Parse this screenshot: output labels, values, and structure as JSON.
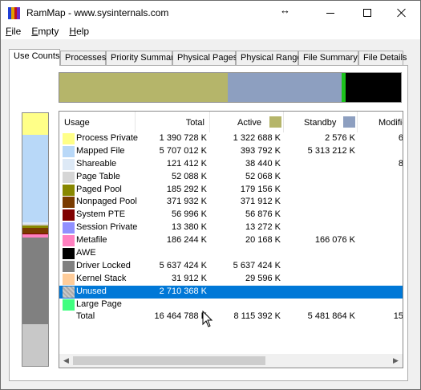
{
  "window": {
    "title": "RamMap - www.sysinternals.com",
    "icon_colors": [
      "#1f3fd6",
      "#e0a000",
      "#c01020",
      "#6a2dc8"
    ]
  },
  "title_controls": {
    "resize_icon": "↔",
    "minimize": "minimize-icon",
    "maximize": "maximize-icon",
    "close": "close-icon"
  },
  "menu": [
    {
      "label": "File",
      "mnemonic": "F",
      "rest": "ile"
    },
    {
      "label": "Empty",
      "mnemonic": "E",
      "rest": "mpty"
    },
    {
      "label": "Help",
      "mnemonic": "H",
      "rest": "elp"
    }
  ],
  "tabs": [
    {
      "label": "Use Counts",
      "active": true
    },
    {
      "label": "Processes",
      "active": false
    },
    {
      "label": "Priority Summary",
      "active": false
    },
    {
      "label": "Physical Pages",
      "active": false
    },
    {
      "label": "Physical Ranges",
      "active": false
    },
    {
      "label": "File Summary",
      "active": false
    },
    {
      "label": "File Details",
      "active": false
    }
  ],
  "summary_bar": {
    "segments": [
      {
        "name": "active",
        "color": "#b5b56a",
        "fraction": 0.493
      },
      {
        "name": "standby",
        "color": "#8d9fc0",
        "fraction": 0.333
      },
      {
        "name": "modified",
        "color": "#1cc21c",
        "fraction": 0.012
      },
      {
        "name": "free",
        "color": "#000000",
        "fraction": 0.162
      }
    ]
  },
  "vertical_bar": {
    "segments": [
      {
        "name": "process-private",
        "color": "#ffff88",
        "fraction": 0.085
      },
      {
        "name": "mapped-file",
        "color": "#b8d8f8",
        "fraction": 0.347
      },
      {
        "name": "shareable",
        "color": "#dde9f6",
        "fraction": 0.007
      },
      {
        "name": "page-table",
        "color": "#d6d6d6",
        "fraction": 0.004
      },
      {
        "name": "paged-pool",
        "color": "#888800",
        "fraction": 0.011
      },
      {
        "name": "nonpaged-pool",
        "color": "#7a3b00",
        "fraction": 0.022
      },
      {
        "name": "system-pte",
        "color": "#800000",
        "fraction": 0.004
      },
      {
        "name": "session-private",
        "color": "#9090ff",
        "fraction": 0.001
      },
      {
        "name": "metafile",
        "color": "#ff80c0",
        "fraction": 0.011
      },
      {
        "name": "driver-locked",
        "color": "#808080",
        "fraction": 0.342
      },
      {
        "name": "kernel-stack",
        "color": "#ffcc99",
        "fraction": 0.002
      },
      {
        "name": "unused",
        "color": "#c8c8c8",
        "fraction": 0.164
      }
    ]
  },
  "table": {
    "headers": {
      "usage": "Usage",
      "total": "Total",
      "active": "Active",
      "standby": "Standby",
      "modified": "Modifie"
    },
    "header_colors": {
      "active": "#b5b56a",
      "standby": "#8d9fc0"
    },
    "rows": [
      {
        "label": "Process Private",
        "color": "#ffff88",
        "total": "1 390 728 K",
        "active": "1 322 688 K",
        "standby": "2 576 K",
        "modified": "6"
      },
      {
        "label": "Mapped File",
        "color": "#b8d8f8",
        "total": "5 707 012 K",
        "active": "393 792 K",
        "standby": "5 313 212 K",
        "modified": ""
      },
      {
        "label": "Shareable",
        "color": "#dde9f6",
        "total": "121 412 K",
        "active": "38 440 K",
        "standby": "",
        "modified": "8"
      },
      {
        "label": "Page Table",
        "color": "#d6d6d6",
        "total": "52 088 K",
        "active": "52 068 K",
        "standby": "",
        "modified": ""
      },
      {
        "label": "Paged Pool",
        "color": "#888800",
        "total": "185 292 K",
        "active": "179 156 K",
        "standby": "",
        "modified": ""
      },
      {
        "label": "Nonpaged Pool",
        "color": "#7a3b00",
        "total": "371 932 K",
        "active": "371 912 K",
        "standby": "",
        "modified": ""
      },
      {
        "label": "System PTE",
        "color": "#800000",
        "total": "56 996 K",
        "active": "56 876 K",
        "standby": "",
        "modified": ""
      },
      {
        "label": "Session Private",
        "color": "#9090ff",
        "total": "13 380 K",
        "active": "13 272 K",
        "standby": "",
        "modified": ""
      },
      {
        "label": "Metafile",
        "color": "#ff80c0",
        "total": "186 244 K",
        "active": "20 168 K",
        "standby": "166 076 K",
        "modified": ""
      },
      {
        "label": "AWE",
        "color": "#000000",
        "total": "",
        "active": "",
        "standby": "",
        "modified": ""
      },
      {
        "label": "Driver Locked",
        "color": "#808080",
        "total": "5 637 424 K",
        "active": "5 637 424 K",
        "standby": "",
        "modified": ""
      },
      {
        "label": "Kernel Stack",
        "color": "#ffcc99",
        "total": "31 912 K",
        "active": "29 596 K",
        "standby": "",
        "modified": ""
      },
      {
        "label": "Unused",
        "color": "#c8c8c8",
        "total": "2 710 368 K",
        "active": "",
        "standby": "",
        "modified": "",
        "selected": true
      },
      {
        "label": "Large Page",
        "color": "#40ff80",
        "total": "",
        "active": "",
        "standby": "",
        "modified": ""
      },
      {
        "label": "Total",
        "color": "",
        "total": "16 464 788 K",
        "active": "8 115 392 K",
        "standby": "5 481 864 K",
        "modified": "15"
      }
    ]
  },
  "scrollbar": {
    "left_arrow": "◀",
    "right_arrow": "▶"
  }
}
